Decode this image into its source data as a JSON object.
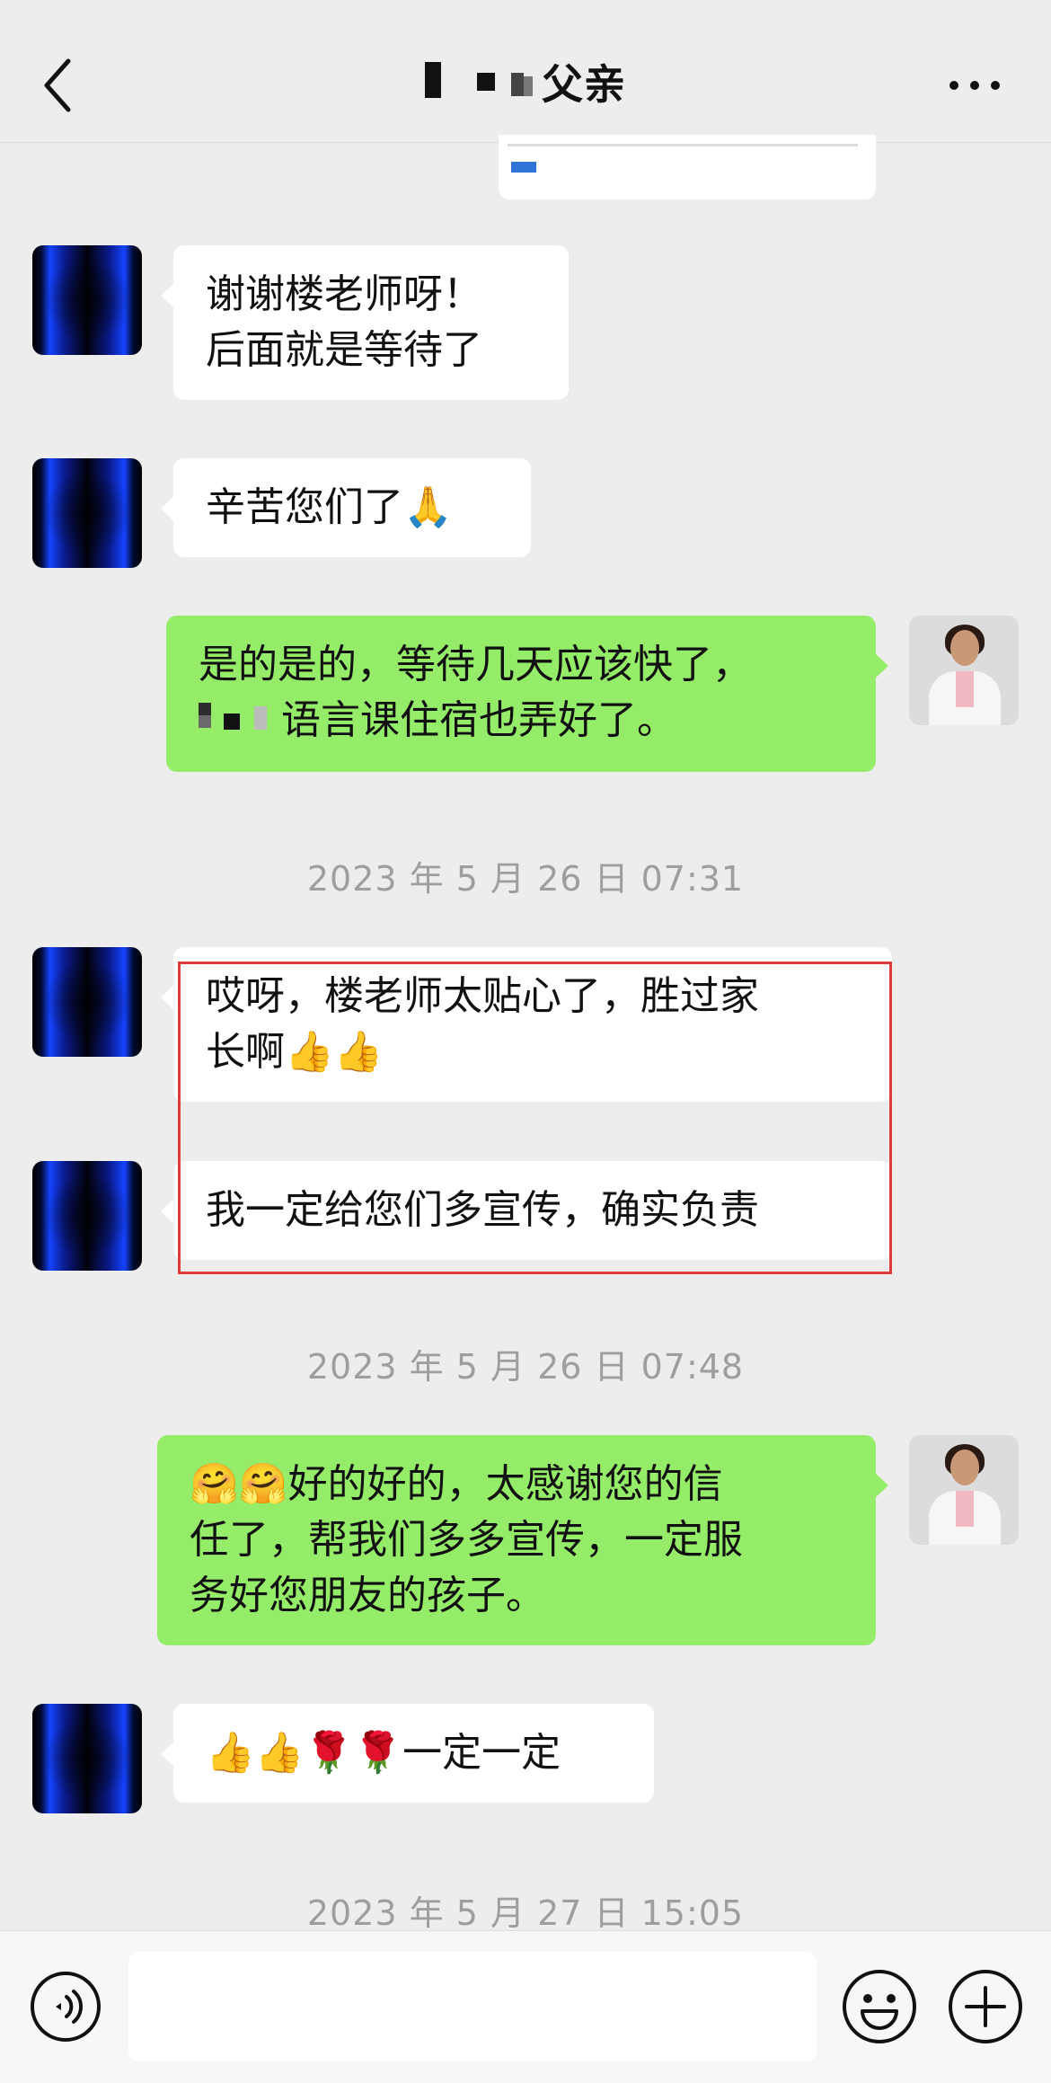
{
  "header": {
    "title": "父亲",
    "back_icon": "chevron-left-icon",
    "more_icon": "more-dots-icon"
  },
  "messages": [
    {
      "side": "left",
      "lines": [
        "谢谢楼老师呀！",
        "后面就是等待了"
      ]
    },
    {
      "side": "left",
      "text": "辛苦您们了",
      "emoji": "🙏"
    },
    {
      "side": "right",
      "line1": "是的是的，等待几天应该快了，",
      "line2": "语言课住宿也弄好了。"
    },
    {
      "side": "left",
      "lines": [
        "哎呀，楼老师太贴心了，胜过家",
        "长啊👍👍"
      ]
    },
    {
      "side": "left",
      "text": "我一定给您们多宣传，确实负责"
    },
    {
      "side": "right",
      "lines": [
        "🤗🤗好的好的，太感谢您的信",
        "任了，帮我们多多宣传，一定服",
        "务好您朋友的孩子。"
      ]
    },
    {
      "side": "left",
      "text": "👍👍🌹🌹一定一定"
    }
  ],
  "timestamps": [
    "2023 年 5 月 26 日 07:31",
    "2023 年 5 月 26 日 07:48",
    "2023 年 5 月 27 日 15:05"
  ],
  "input_bar": {
    "voice_icon": "voice-icon",
    "emoji_icon": "emoji-icon",
    "plus_icon": "plus-icon"
  },
  "colors": {
    "background": "#ededed",
    "sent_bubble": "#95ec69",
    "received_bubble": "#ffffff",
    "highlight_border": "#e03b3b",
    "timestamp": "#9e9e9e"
  }
}
